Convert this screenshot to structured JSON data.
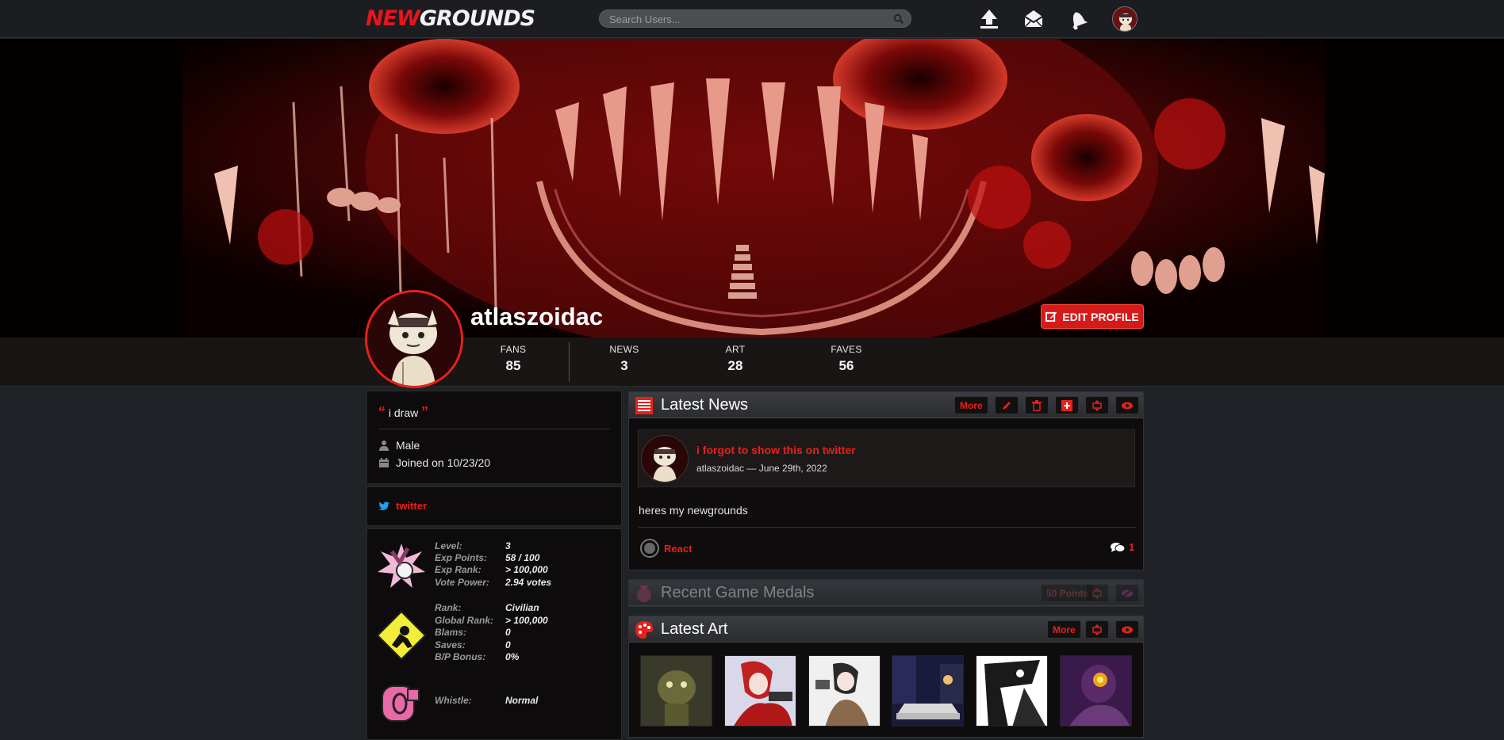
{
  "topbar": {
    "logo_new": "NEW",
    "logo_grounds": "GROUNDS",
    "search_placeholder": "Search Users..."
  },
  "profile": {
    "username": "atlaszoidac",
    "edit_label": "EDIT PROFILE",
    "stats": [
      {
        "label": "FANS",
        "value": "85"
      },
      {
        "label": "NEWS",
        "value": "3"
      },
      {
        "label": "ART",
        "value": "28"
      },
      {
        "label": "FAVES",
        "value": "56"
      }
    ]
  },
  "about": {
    "quote": "i draw",
    "gender": "Male",
    "joined": "Joined on 10/23/20",
    "link": "twitter"
  },
  "level_stats": [
    {
      "k": "Level:",
      "v": "3"
    },
    {
      "k": "Exp Points:",
      "v": "58 / 100"
    },
    {
      "k": "Exp Rank:",
      "v": "> 100,000"
    },
    {
      "k": "Vote Power:",
      "v": "2.94 votes"
    }
  ],
  "rank_stats": [
    {
      "k": "Rank:",
      "v": "Civilian"
    },
    {
      "k": "Global Rank:",
      "v": "> 100,000"
    },
    {
      "k": "Blams:",
      "v": "0"
    },
    {
      "k": "Saves:",
      "v": "0"
    },
    {
      "k": "B/P Bonus:",
      "v": "0%"
    }
  ],
  "whistle": {
    "k": "Whistle:",
    "v": "Normal"
  },
  "news_card": {
    "title": "Latest News",
    "more": "More",
    "post_title": "i forgot to show this on twitter",
    "post_meta": "atlaszoidac — June 29th, 2022",
    "post_body": "heres my newgrounds",
    "react": "React",
    "comment_count": "1"
  },
  "medals_card": {
    "title": "Recent Game Medals",
    "points": "50 Points"
  },
  "art_card": {
    "title": "Latest Art",
    "more": "More"
  },
  "colors": {
    "accent": "#e8201a",
    "background": "#1f2226"
  }
}
